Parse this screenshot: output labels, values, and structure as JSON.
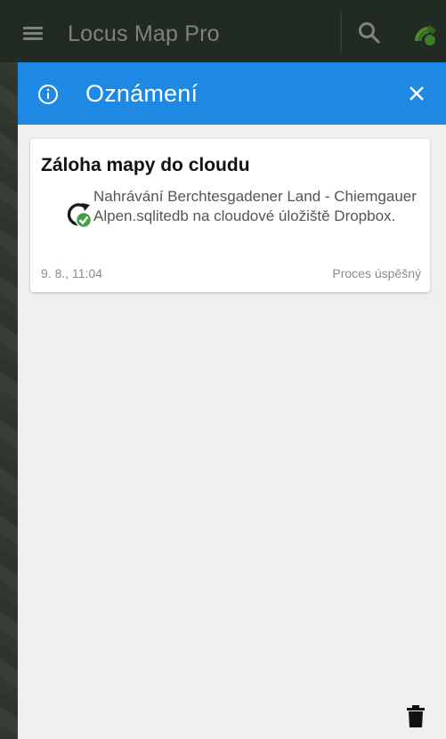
{
  "app_bar": {
    "title": "Locus Map Pro",
    "menu_icon": "hamburger-menu-icon",
    "search_icon": "search-icon",
    "gps_icon": "gps-satellite-icon"
  },
  "dialog": {
    "title": "Oznámení",
    "header_icon": "info-icon",
    "close_icon": "close-icon",
    "header_color": "#1e88e5",
    "notifications": [
      {
        "title": "Záloha mapy do cloudu",
        "icon": "sync-success-icon",
        "message": "Nahrávání Berchtesgadener Land - Chiemgauer Alpen.sqlitedb na cloudové úložiště Dropbox.",
        "time": "9. 8., 11:04",
        "status": "Proces úspěšný"
      }
    ],
    "delete_icon": "trash-icon"
  }
}
